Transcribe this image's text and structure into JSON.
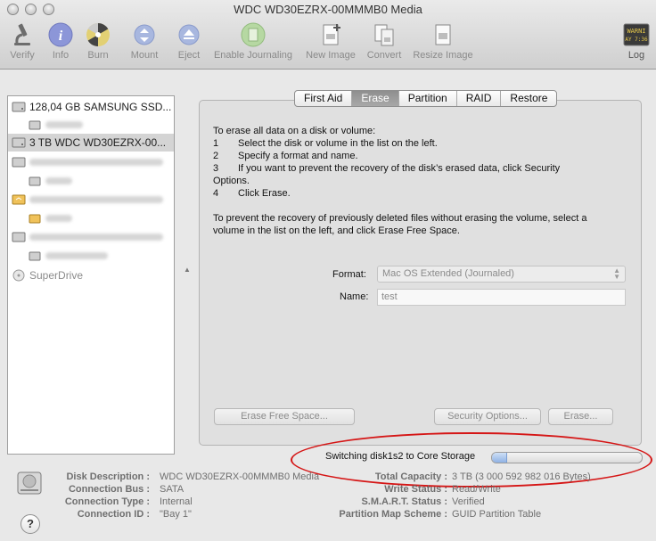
{
  "window": {
    "title": "WDC WD30EZRX-00MMMB0 Media"
  },
  "toolbar": {
    "verify": "Verify",
    "info": "Info",
    "burn": "Burn",
    "mount": "Mount",
    "eject": "Eject",
    "enable_journaling": "Enable Journaling",
    "new_image": "New Image",
    "convert": "Convert",
    "resize_image": "Resize Image",
    "log": "Log",
    "log_icon_text_1": "WARNI",
    "log_icon_text_2": "AY 7:36"
  },
  "sidebar": {
    "items": [
      {
        "label": "128,04 GB SAMSUNG SSD..."
      },
      {
        "label": "3 TB WDC WD30EZRX-00..."
      },
      {
        "label": "SuperDrive"
      }
    ]
  },
  "tabs": [
    "First Aid",
    "Erase",
    "Partition",
    "RAID",
    "Restore"
  ],
  "erase": {
    "intro": "To erase all data on a disk or volume:",
    "steps": [
      {
        "n": "1",
        "text": "Select the disk or volume in the list on the left."
      },
      {
        "n": "2",
        "text": "Specify a format and name."
      },
      {
        "n": "3",
        "text": "If you want to prevent the recovery of the disk’s erased data, click Security"
      },
      {
        "n": "4",
        "text": "Click Erase."
      }
    ],
    "step3_cont": "Options.",
    "free_space_1": "To prevent the recovery of previously deleted files without erasing the volume, select a",
    "free_space_2": "volume in the list on the left, and click Erase Free Space.",
    "format_label": "Format:",
    "format_value": "Mac OS Extended (Journaled)",
    "name_label": "Name:",
    "name_value": "test",
    "erase_free_space_btn": "Erase Free Space...",
    "security_options_btn": "Security Options...",
    "erase_btn": "Erase..."
  },
  "status": {
    "text": "Switching disk1s2 to Core Storage",
    "progress": 0.1
  },
  "info": {
    "disk_description_key": "Disk Description :",
    "disk_description": "WDC WD30EZRX-00MMMB0 Media",
    "connection_bus_key": "Connection Bus :",
    "connection_bus": "SATA",
    "connection_type_key": "Connection Type :",
    "connection_type": "Internal",
    "connection_id_key": "Connection ID :",
    "connection_id": "\"Bay 1\"",
    "total_capacity_key": "Total Capacity :",
    "total_capacity": "3 TB (3 000 592 982 016 Bytes)",
    "write_status_key": "Write Status :",
    "write_status": "Read/Write",
    "smart_status_key": "S.M.A.R.T. Status :",
    "smart_status": "Verified",
    "partition_map_key": "Partition Map Scheme :",
    "partition_map": "GUID Partition Table"
  },
  "help": {
    "label": "?"
  },
  "colors": {
    "annotation_red": "#d51616",
    "selection": "#d4d4d4",
    "progress_fill": "#8fb2e4"
  }
}
